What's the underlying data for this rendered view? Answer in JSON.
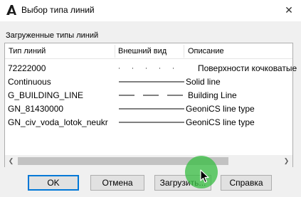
{
  "window": {
    "title": "Выбор типа линий",
    "icon": "autocad-a-icon",
    "close_glyph": "✕"
  },
  "list": {
    "group_label": "Загруженные типы линий",
    "columns": [
      "Тип линий",
      "Внешний вид",
      "Описание"
    ],
    "rows": [
      {
        "name": "72222000",
        "preview": "dotted",
        "description": "Поверхности кочковатые"
      },
      {
        "name": "Continuous",
        "preview": "solid",
        "description": "Solid line"
      },
      {
        "name": "G_BUILDING_LINE",
        "preview": "dashed",
        "description": "Building Line"
      },
      {
        "name": "GN_81430000",
        "preview": "solid",
        "description": "GeoniCS line type"
      },
      {
        "name": "GN_civ_voda_lotok_neukr",
        "preview": "solid",
        "description": "GeoniCS line type"
      }
    ]
  },
  "scrollbar": {
    "left_arrow": "❮",
    "right_arrow": "❯",
    "scroll_position": 0.6
  },
  "buttons": {
    "ok": "OK",
    "cancel": "Отмена",
    "load": "Загрузить...",
    "help": "Справка"
  },
  "colors": {
    "accent": "#0078d7",
    "dialog_bg": "#f0f0f0",
    "cursor_halo": "#3cbe46"
  }
}
